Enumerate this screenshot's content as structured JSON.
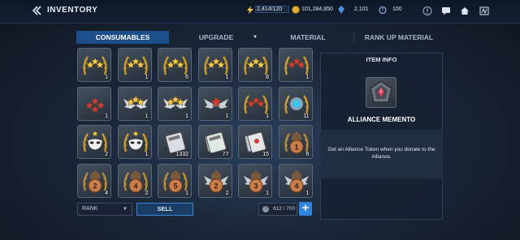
{
  "header": {
    "title": "INVENTORY",
    "energy": "2,414/120",
    "gold": "101,284,850",
    "crystals": "2,101",
    "timer_value": "100"
  },
  "tabs": [
    {
      "label": "CONSUMABLES",
      "active": true
    },
    {
      "label": "UPGRADE",
      "active": false
    },
    {
      "label": "MATERIAL",
      "active": false
    },
    {
      "label": "RANK UP MATERIAL",
      "active": false
    }
  ],
  "grid": {
    "rows": [
      [
        {
          "icon": "gold-stars-laurel-icon",
          "count": "1"
        },
        {
          "icon": "gold-stars-laurel-icon",
          "count": "1"
        },
        {
          "icon": "gold-stars-laurel-icon",
          "count": "6"
        },
        {
          "icon": "gold-stars-laurel-icon",
          "count": "1"
        },
        {
          "icon": "gold-stars-laurel-icon",
          "count": "8"
        },
        {
          "icon": "red-stars-laurel-icon",
          "count": "1"
        }
      ],
      [
        {
          "icon": "red-stars-icon",
          "count": "1"
        },
        {
          "icon": "winged-gold-stars-icon",
          "count": "1"
        },
        {
          "icon": "winged-gold-stars-icon",
          "count": "1"
        },
        {
          "icon": "winged-red-star-icon",
          "count": "1"
        },
        {
          "icon": "red-stars-laurel-icon",
          "count": "1"
        },
        {
          "icon": "blue-gem-laurel-icon",
          "count": "11"
        }
      ],
      [
        {
          "icon": "mask-laurel-icon",
          "count": "2"
        },
        {
          "icon": "mask-laurel-icon",
          "count": "1"
        },
        {
          "icon": "ticket-icon",
          "count": "1332"
        },
        {
          "icon": "double-ticket-icon",
          "count": "77"
        },
        {
          "icon": "red-ticket-icon",
          "count": "15"
        },
        {
          "icon": "bronze-medal-1-icon",
          "count": "6"
        }
      ],
      [
        {
          "icon": "bronze-medal-2-icon",
          "count": "4"
        },
        {
          "icon": "bronze-medal-4-icon",
          "count": "2"
        },
        {
          "icon": "bronze-medal-5-icon",
          "count": "1"
        },
        {
          "icon": "winged-medal-2-icon",
          "count": "2"
        },
        {
          "icon": "winged-medal-3-icon",
          "count": "1"
        },
        {
          "icon": "winged-medal-4-icon",
          "count": "1"
        }
      ]
    ]
  },
  "info": {
    "header": "ITEM INFO",
    "item_name": "ALLIANCE MEMENTO",
    "description": "Get an Alliance Token when you donate to the Alliance."
  },
  "footer": {
    "sort_label": "RANK",
    "sell_label": "SELL",
    "capacity": "612 / 700",
    "help": "?",
    "add": "+"
  },
  "colors": {
    "accent_blue": "#2f86e0",
    "active_tab": "#1c4f8a",
    "gold": "#f2c94c",
    "red": "#d33a3a"
  }
}
